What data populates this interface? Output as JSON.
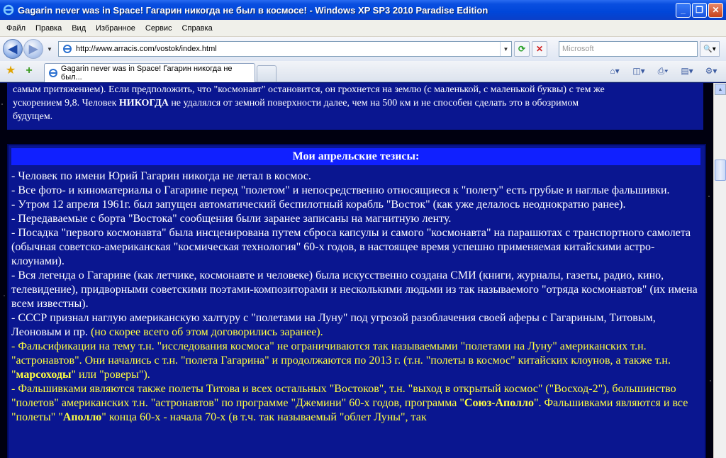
{
  "window": {
    "title": "Gagarin never was in Space! Гагарин никогда не был в космосе! - Windows XP SP3 2010 Paradise Edition"
  },
  "menu": [
    "Файл",
    "Правка",
    "Вид",
    "Избранное",
    "Сервис",
    "Справка"
  ],
  "address": {
    "url": "http://www.arracis.com/vostok/index.html",
    "search_placeholder": "Microsoft"
  },
  "tab": {
    "title": "Gagarin never was in Space! Гагарин никогда не был..."
  },
  "content": {
    "intro_line1": "самым притяжением). Если предположить, что \"космонавт\" остановится, он грохнется на землю (с маленькой, с маленькой буквы) с тем же",
    "intro_line2a": "ускорением 9,8. Человек ",
    "intro_never": "НИКОГДА",
    "intro_line2b": " не удалялся от земной поверхности далее, чем на 500 км и не способен сделать это в обозримом",
    "intro_line3": "будущем.",
    "thesis_heading": "Мои апрельские тезисы:",
    "t1": "- Человек по имени Юрий Гагарин никогда не летал в космос.",
    "t2": "- Все фото- и киноматериалы о Гагарине перед \"полетом\" и непосредственно относящиеся к \"полету\" есть грубые и наглые фальшивки.",
    "t3": "- Утром 12 апреля 1961г. был запущен автоматический беспилотный корабль \"Восток\" (как уже делалось неоднократно ранее).",
    "t4": "- Передаваемые с борта \"Востока\" сообщения были заранее записаны на магнитную ленту.",
    "t5": "- Посадка \"первого космонавта\" была инсценирована путем сброса капсулы и самого \"космонавта\" на парашютах с транспортного самолета (обычная советско-американская \"космическая технология\" 60-х годов, в настоящее время успешно применяемая китайскими астро-клоунами).",
    "t6": "- Вся легенда о Гагарине (как летчике, космонавте и человеке) была искусственно создана СМИ (книги, журналы, газеты, радио, кино, телевидение), придворными советскими поэтами-композиторами и несколькими людьми из так называемого \"отряда космонавтов\" (их имена всем известны).",
    "t7a": "- СССР признал наглую американскую халтуру с \"полетами на Луну\" под угрозой разоблачения своей аферы с Гагариным, Титовым, Леоновым и пр. ",
    "t7b": "(но скорее всего об этом договорились заранее).",
    "t8a": "- Фальсификации на тему т.н. \"исследования космоса\" не ограничиваются так называемыми \"полетами на Луну\" американских т.н. \"астронавтов\". Они начались с т.н. \"полета Гагарина\" и продолжаются по 2013 г. (т.н. \"полеты в космос\" китайских клоунов, а также т.н. \"",
    "t8b": "марсоходы",
    "t8c": "\" или \"роверы\").",
    "t9a": "- Фальшивками являются также полеты Титова и всех остальных \"Востоков\", т.н. \"выход в открытый космос\" (\"Восход-2\"), большинство \"полетов\" американских т.н. \"астронавтов\" по программе \"Джемини\" 60-х годов,  программа \"",
    "t9b": "Союз-Аполло",
    "t9c": "\". Фальшивками являются и все \"полеты\" \"",
    "t9d": "Аполло",
    "t9e": "\" конца 60-х - начала 70-х (в т.ч. так называемый \"облет Луны\", так"
  }
}
